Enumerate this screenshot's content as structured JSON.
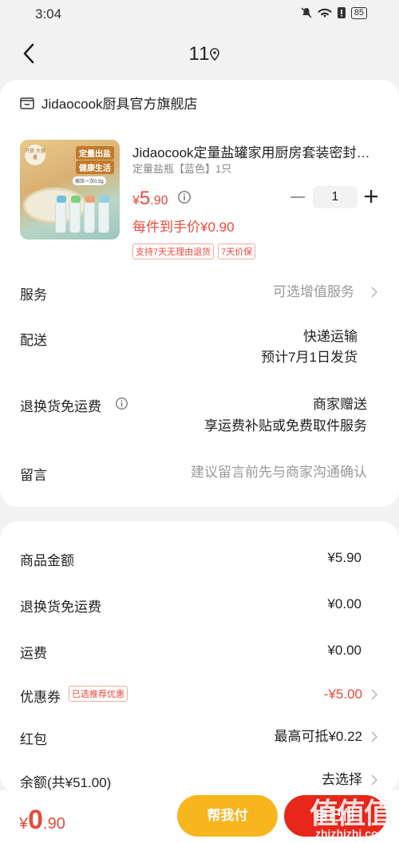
{
  "status_bar": {
    "time": "3:04",
    "battery": "85"
  },
  "nav": {
    "title": "11"
  },
  "shop": {
    "name": "Jidaocook厨具官方旗舰店"
  },
  "product": {
    "image_texts": {
      "badge": "开放 大容量",
      "line1": "定量出盐",
      "line2": "健康生活",
      "line3": "按压一次0.5g"
    },
    "title": "Jidaocook定量盐罐家用厨房套装密封防潮",
    "spec": "定量盐瓶【蓝色】1只",
    "price_symbol": "¥",
    "price_int": "5",
    "price_dec": ".90",
    "quantity": "1",
    "per_price": "每件到手价¥0.90",
    "tags": [
      "支持7天无理由退货",
      "7天价保"
    ]
  },
  "details": {
    "service": {
      "label": "服务",
      "value": "可选增值服务"
    },
    "delivery": {
      "label": "配送",
      "value1": "快递运输",
      "value2": "预计7月1日发货"
    },
    "return_fee": {
      "label": "退换货免运费",
      "value1": "商家赠送",
      "value2": "享运费补贴或免费取件服务"
    },
    "message": {
      "label": "留言",
      "placeholder": "建议留言前先与商家沟通确认"
    }
  },
  "summary": {
    "goods_amount": {
      "label": "商品金额",
      "value": "¥5.90"
    },
    "return_fee": {
      "label": "退换货免运费",
      "value": "¥0.00"
    },
    "shipping": {
      "label": "运费",
      "value": "¥0.00"
    },
    "coupon": {
      "label": "优惠券",
      "badge": "已选推荐优惠",
      "value": "-¥5.00"
    },
    "red_packet": {
      "label": "红包",
      "value": "最高可抵¥0.22"
    },
    "balance": {
      "label": "余额(共¥51.00)",
      "value": "去选择"
    }
  },
  "bottom": {
    "total_symbol": "¥",
    "total_int": "0",
    "total_dec": ".90",
    "help_pay": "帮我付",
    "self_pay": "自己付"
  },
  "watermark": {
    "logo": "值值值",
    "text": "zhizhizhi.com"
  },
  "colors": {
    "accent_red": "#e84a3b",
    "button_yellow": "#f7b51e",
    "button_red": "#e8271a"
  }
}
